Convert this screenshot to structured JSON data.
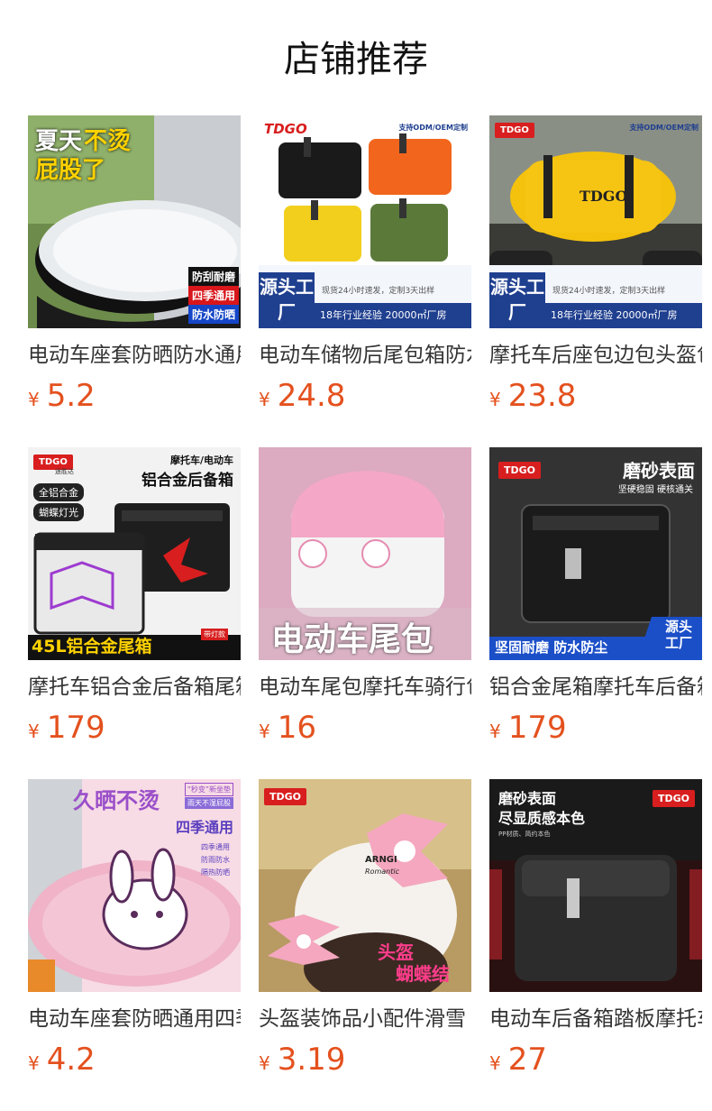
{
  "page": {
    "title": "店铺推荐"
  },
  "currency": "¥",
  "products": [
    {
      "title": "电动车座套防晒防水通用",
      "price": "5.2",
      "image": {
        "badges": [
          "夏天",
          "不烫",
          "屁股了"
        ],
        "tags": [
          "防刮耐磨",
          "四季通用",
          "防水防晒"
        ]
      }
    },
    {
      "title": "电动车储物后尾包箱防水",
      "price": "24.8",
      "image": {
        "brand": "TDGO",
        "top_note": "支持ODM/OEM定制",
        "badge": "源头工厂",
        "note": "现货24小时速发，定制3天出样",
        "strip": "18年行业经验 20000㎡厂房"
      }
    },
    {
      "title": "摩托车后座包边包头盔包",
      "price": "23.8",
      "image": {
        "brand": "TDGO",
        "top_note": "支持ODM/OEM定制",
        "badge": "源头工厂",
        "note": "现货24小时速发，定制3天出样",
        "strip": "18年行业经验 20000㎡厂房"
      }
    },
    {
      "title": "摩托车铝合金后备箱尾箱",
      "price": "179",
      "image": {
        "brand": "TDGO",
        "brand_sub": "途胜达",
        "heading": "摩托车/电动车",
        "subheading": "铝合金后备箱",
        "chips": [
          "全铝合金",
          "蝴蝶灯光"
        ],
        "bottom": "45L铝合金尾箱",
        "lamp_note": "带灯款"
      }
    },
    {
      "title": "电动车尾包摩托车骑行包",
      "price": "16",
      "image": {
        "caption": "电动车尾包"
      }
    },
    {
      "title": "铝合金尾箱摩托车后备箱",
      "price": "179",
      "image": {
        "brand": "TDGO",
        "heading": "磨砂表面",
        "subheading": "坚硬稳固 硬核通关",
        "badge": "源头工厂",
        "bottom": "坚固耐磨 防水防尘"
      }
    },
    {
      "title": "电动车座套防晒通用四季",
      "price": "4.2",
      "image": {
        "heading": "久晒不烫",
        "chip": "“秒变”新坐垫",
        "chip2": "雨天不湿屁股",
        "subheading": "四季通用",
        "features": [
          "四季通用",
          "防雨防水",
          "隔热防晒"
        ]
      }
    },
    {
      "title": "头盔装饰品小配件滑雪",
      "price": "3.19",
      "image": {
        "brand": "TDGO",
        "caption1": "头盔",
        "caption2": "蝴蝶结",
        "helmet_text": "ARNGI",
        "helmet_text2": "Romantic"
      }
    },
    {
      "title": "电动车后备箱踏板摩托车",
      "price": "27",
      "image": {
        "brand": "TDGO",
        "heading": "磨砂表面",
        "subheading": "尽显质感本色",
        "note": "PP材质、简约本色"
      }
    }
  ]
}
